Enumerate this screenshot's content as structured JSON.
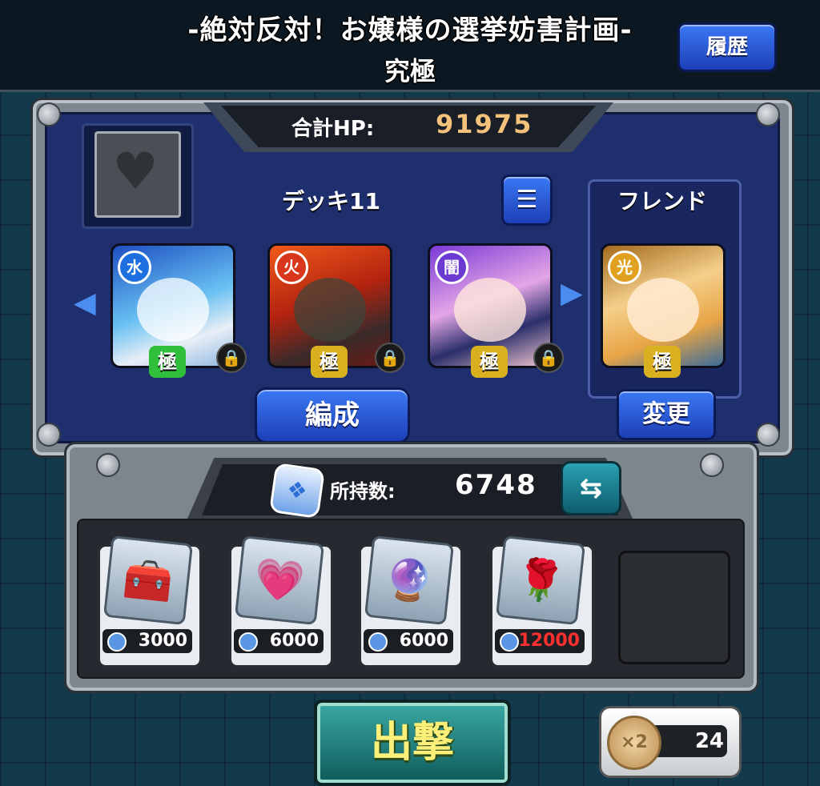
{
  "header": {
    "quest_title": "-絶対反対！お嬢様の選挙妨害計画-",
    "difficulty": "究極",
    "history_label": "履歴"
  },
  "deck": {
    "hp_label": "合計HP:",
    "hp_value": "91975",
    "deck_name": "デッキ11",
    "friend_label": "フレンド",
    "formation_label": "編成",
    "change_label": "変更",
    "characters": [
      {
        "element": "水",
        "element_color": "#1d6fe0",
        "rank": "極",
        "rank_color": "#2fbf3a",
        "locked": true
      },
      {
        "element": "火",
        "element_color": "#d8371c",
        "rank": "極",
        "rank_color": "#d8b020",
        "locked": true
      },
      {
        "element": "闇",
        "element_color": "#6b3ad0",
        "rank": "極",
        "rank_color": "#d8b020",
        "locked": true
      },
      {
        "element": "光",
        "element_color": "#e0a020",
        "rank": "極",
        "rank_color": "#d8b020",
        "locked": false
      }
    ]
  },
  "items": {
    "owned_label": "所持数:",
    "owned_count": "6748",
    "slots": [
      {
        "icon": "treasure-chest-icon",
        "glyph": "🧰",
        "price": "3000",
        "price_color": "#ffffff"
      },
      {
        "icon": "heart-plus-icon",
        "glyph": "💗",
        "price": "6000",
        "price_color": "#ffffff"
      },
      {
        "icon": "energy-orb-icon",
        "glyph": "🔮",
        "price": "6000",
        "price_color": "#ffffff"
      },
      {
        "icon": "rose-heart-icon",
        "glyph": "🌹",
        "price": "12000",
        "price_color": "#ff3030"
      }
    ]
  },
  "bottom": {
    "sortie_label": "出撃",
    "stamina_multiplier": "×2",
    "stamina_value": "24"
  }
}
